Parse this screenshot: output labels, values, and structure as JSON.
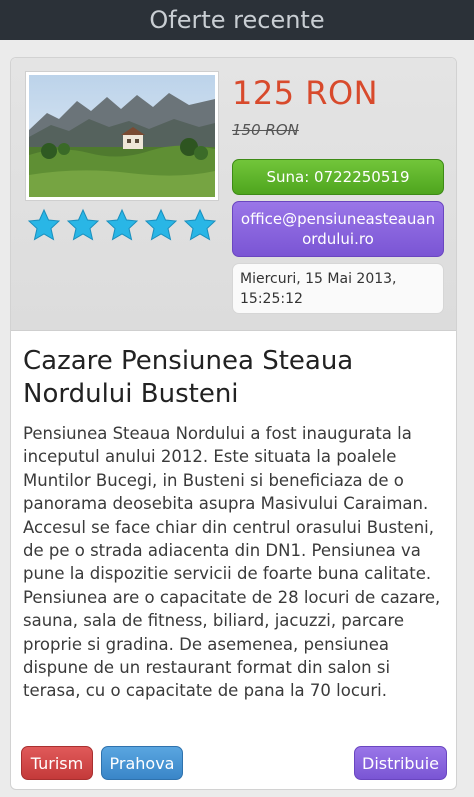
{
  "header": {
    "title": "Oferte recente"
  },
  "offer": {
    "image": "mountain-guesthouse-photo",
    "rating": 5,
    "price": "125 RON",
    "old_price": "150 RON",
    "phone_button": "Suna: 0722250519",
    "email_button": "office@pensiuneasteauanordului.ro",
    "date": "Miercuri, 15 Mai 2013, 15:25:12",
    "title": "Cazare Pensiunea Steaua Nordului Busteni",
    "description": "Pensiunea Steaua Nordului a fost inaugurata la inceputul anului 2012. Este situata la poalele Muntilor Bucegi, in Busteni si beneficiaza de o panorama deosebita asupra Masivului Caraiman. Accesul se face chiar din centrul orasului Busteni, de pe o strada adiacenta din DN1. Pensiunea va pune la dispozitie servicii de foarte buna calitate. Pensiunea are o capacitate de 28 locuri de cazare, sauna, sala de fitness, biliard, jacuzzi, parcare proprie si gradina. De asemenea, pensiunea dispune de un restaurant format din salon si terasa, cu o capacitate de pana la 70 locuri."
  },
  "tags": {
    "turism": "Turism",
    "prahova": "Prahova",
    "share": "Distribuie"
  },
  "colors": {
    "price": "#d84a2c",
    "phone_button": "#5cb428",
    "email_button": "#8663dd",
    "star": "#29b6e6"
  }
}
